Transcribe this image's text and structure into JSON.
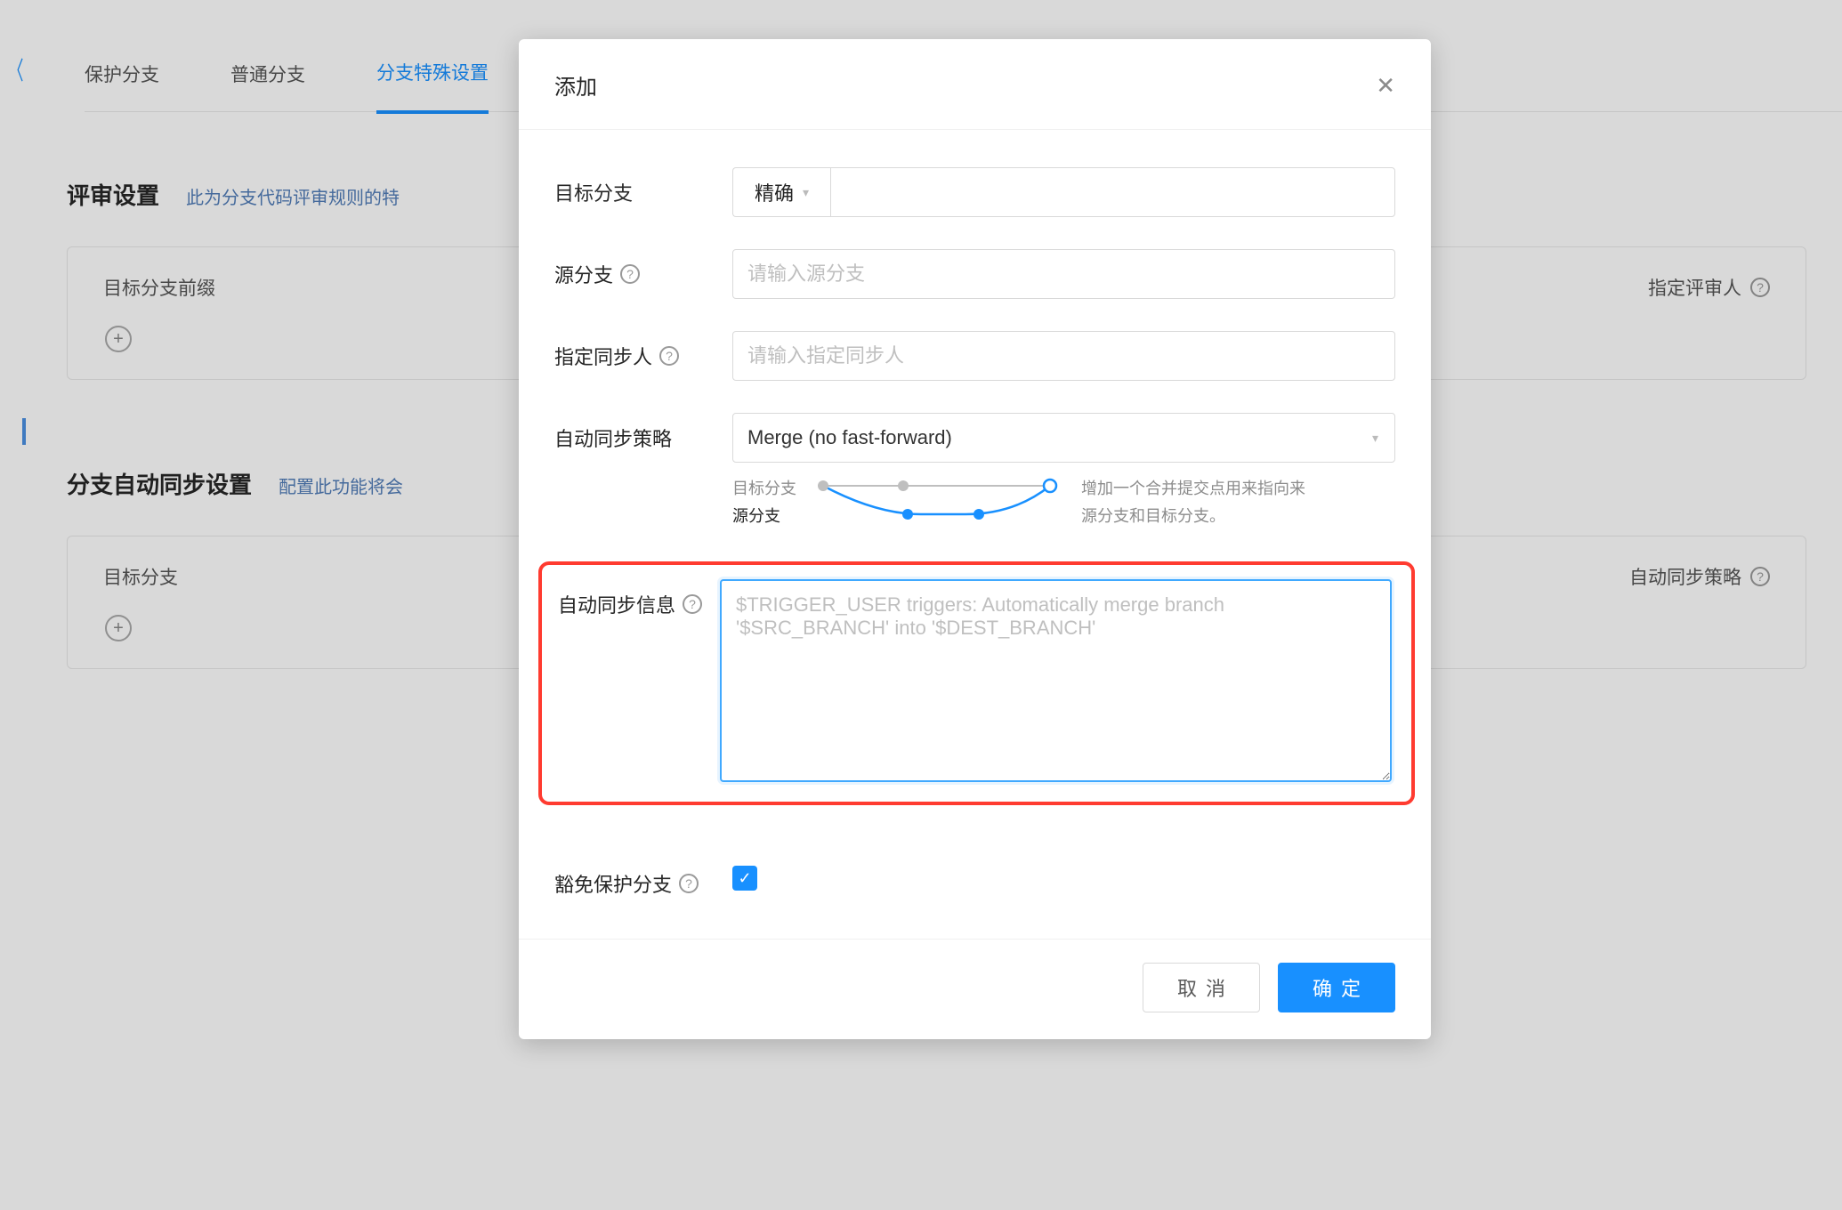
{
  "tabs": {
    "protected": "保护分支",
    "normal": "普通分支",
    "special": "分支特殊设置"
  },
  "review_section": {
    "title": "评审设置",
    "desc": "此为分支代码评审规则的特",
    "card_label": "目标分支前缀",
    "card_right": "指定评审人"
  },
  "sync_section": {
    "title": "分支自动同步设置",
    "desc": "配置此功能将会",
    "card_label": "目标分支",
    "card_right": "自动同步策略"
  },
  "modal": {
    "title": "添加",
    "labels": {
      "target_branch": "目标分支",
      "source_branch": "源分支",
      "sync_user": "指定同步人",
      "strategy": "自动同步策略",
      "message": "自动同步信息",
      "exempt": "豁免保护分支"
    },
    "match_mode": "精确",
    "source_branch_placeholder": "请输入源分支",
    "sync_user_placeholder": "请输入指定同步人",
    "strategy_value": "Merge (no fast-forward)",
    "diagram": {
      "target": "目标分支",
      "source": "源分支",
      "desc": "增加一个合并提交点用来指向来源分支和目标分支。"
    },
    "message_placeholder": "$TRIGGER_USER triggers: Automatically merge branch '$SRC_BRANCH' into '$DEST_BRANCH'",
    "exempt_checked": true,
    "footer": {
      "cancel": "取消",
      "ok": "确定"
    }
  },
  "icons": {
    "help": "?",
    "add": "+",
    "close": "✕",
    "check": "✓"
  }
}
